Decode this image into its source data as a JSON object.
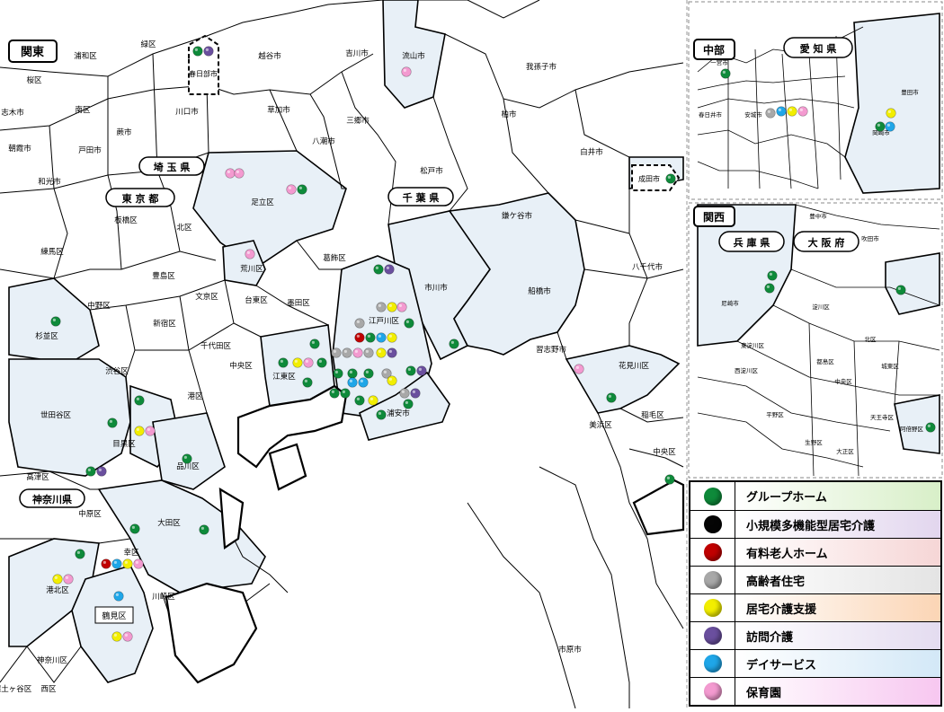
{
  "region_titles": {
    "kanto": "関東",
    "chubu": "中部",
    "kansai": "関西"
  },
  "prefectures": {
    "saitama": "埼 玉 県",
    "tokyo": "東 京 都",
    "chiba": "千 葉 県",
    "kanagawa": "神奈川県",
    "aichi": "愛 知 県",
    "hyogo": "兵 庫 県",
    "osaka": "大 阪 府"
  },
  "places": {
    "kasukabe": "春日部市",
    "narita": "成田市",
    "tsurumi": "鶴見区"
  },
  "district_labels": [
    "桜区",
    "浦和区",
    "緑区",
    "越谷市",
    "吉川市",
    "流山市",
    "我孫子市",
    "志木市",
    "朝霞市",
    "和光市",
    "戸田市",
    "南区",
    "蕨市",
    "川口市",
    "草加市",
    "三郷市",
    "八潮市",
    "柏市",
    "松戸市",
    "白井市",
    "足立区",
    "板橋区",
    "北区",
    "練馬区",
    "豊島区",
    "荒川区",
    "葛飾区",
    "鎌ケ谷市",
    "八千代市",
    "市川市",
    "船橋市",
    "中野区",
    "杉並区",
    "新宿区",
    "文京区",
    "台東区",
    "墨田区",
    "江戸川区",
    "千代田区",
    "中央区",
    "江東区",
    "渋谷区",
    "港区",
    "習志野市",
    "花見川区",
    "世田谷区",
    "目黒区",
    "品川区",
    "浦安市",
    "美浜区",
    "稲毛区",
    "中央区",
    "高津区",
    "中原区",
    "大田区",
    "幸区",
    "港北区",
    "川崎区",
    "神奈川区",
    "保土ヶ谷区",
    "西区",
    "市原市",
    "一宮市",
    "春日井市",
    "豊田市",
    "安城市",
    "岡崎市",
    "尼崎市",
    "豊中市",
    "吹田市",
    "淀川区",
    "東淀川区",
    "北区",
    "都島区",
    "城東区",
    "中央区",
    "天王寺区",
    "阿倍野区",
    "生野区",
    "大正区",
    "平野区",
    "西淀川区",
    "西区"
  ],
  "legend": [
    {
      "label": "グループホーム",
      "color": "#0e8a3a",
      "bg": "#d8efc8"
    },
    {
      "label": "小規模多機能型居宅介護",
      "color": "#050505",
      "bg": "#e2d6ee"
    },
    {
      "label": "有料老人ホーム",
      "color": "#c00000",
      "bg": "#f6d6d6"
    },
    {
      "label": "高齢者住宅",
      "color": "#a8a8a8",
      "bg": "#e4e4e4"
    },
    {
      "label": "居宅介護支援",
      "color": "#f2ee00",
      "bg": "#fbd5b5"
    },
    {
      "label": "訪問介護",
      "color": "#6a4f9e",
      "bg": "#e4dcf0"
    },
    {
      "label": "デイサービス",
      "color": "#1fa6e8",
      "bg": "#d3e8f7"
    },
    {
      "label": "保育園",
      "color": "#f39ad0",
      "bg": "#f7c7f0"
    }
  ]
}
